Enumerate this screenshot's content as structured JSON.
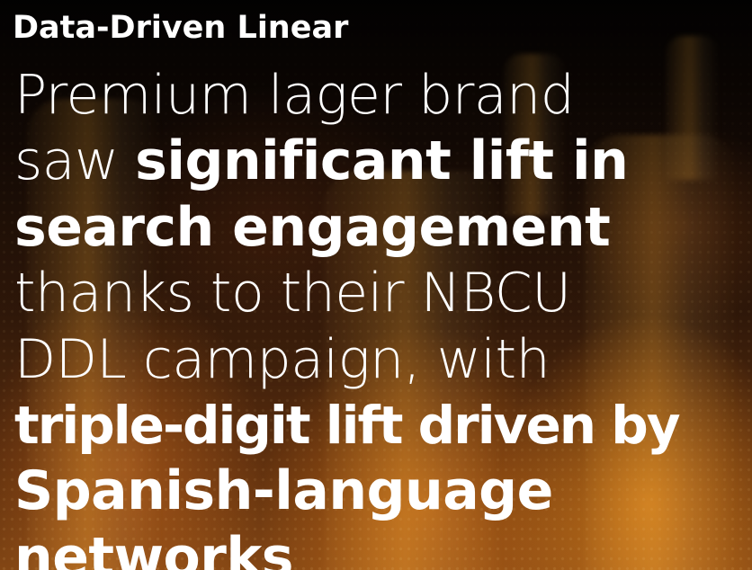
{
  "label": "Data-Driven Linear",
  "headline": {
    "line1_light": "Premium lager brand",
    "line2_light": "saw ",
    "line2_bold": "significant lift in",
    "line3_bold": "search engagement",
    "line4_light": "thanks to their NBCU",
    "line5_light": "DDL campaign, with",
    "line6_bold": "triple-digit lift driven by",
    "line7_bold": "Spanish-language",
    "line8_bold": "networks"
  },
  "colors": {
    "text": "#ffffff",
    "background_dark": "#0d0705",
    "background_amber": "#8a4a15"
  }
}
